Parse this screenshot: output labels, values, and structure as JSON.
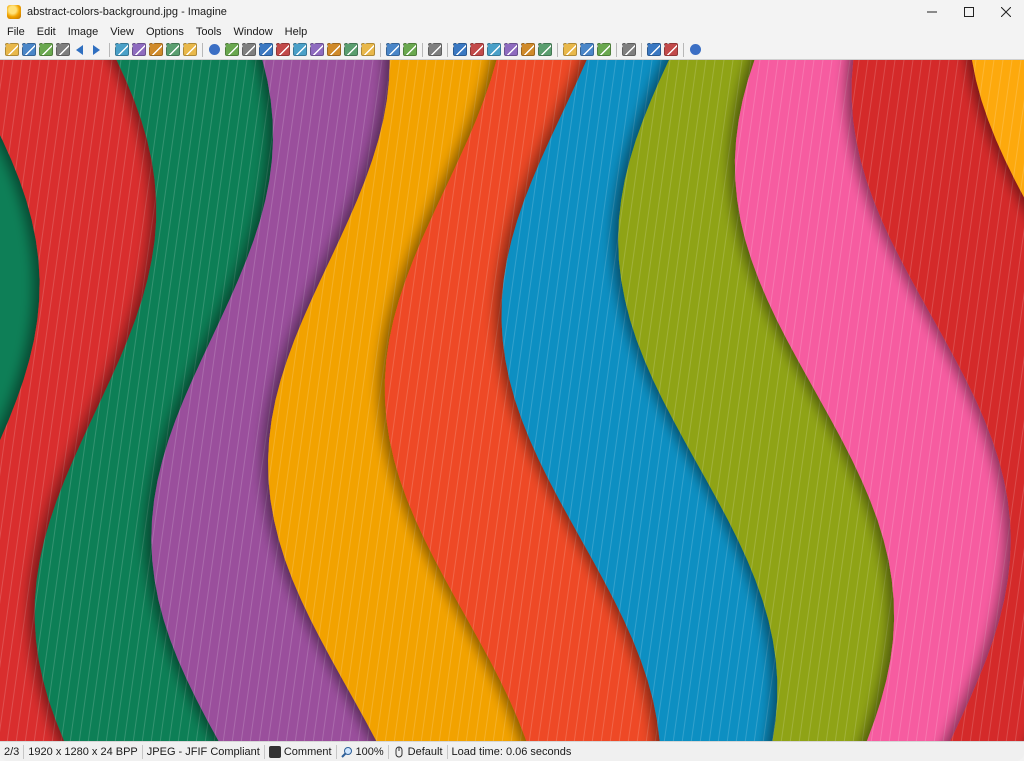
{
  "window": {
    "title": "abstract-colors-background.jpg - Imagine"
  },
  "menu": [
    "File",
    "Edit",
    "Image",
    "View",
    "Options",
    "Tools",
    "Window",
    "Help"
  ],
  "toolbar": {
    "icons": [
      "new-icon",
      "open-icon",
      "save-icon",
      "print-icon",
      "prev-icon",
      "next-icon",
      "sep",
      "cut-icon",
      "copy-icon",
      "paste-icon",
      "undo-icon",
      "redo-icon",
      "sep",
      "info-icon",
      "camera-icon",
      "scanner-icon",
      "rotate-icon",
      "gradient-icon",
      "color-icon",
      "convert-icon",
      "resize-icon",
      "crop-icon",
      "effects-icon",
      "sep",
      "slideshow-icon",
      "fullscreen-icon",
      "sep",
      "refresh-icon",
      "sep",
      "zoom-in-icon",
      "zoom-out-icon",
      "zoom-fit-icon",
      "zoom-actual-icon",
      "zoom-window-icon",
      "thumbnail-icon",
      "sep",
      "monitor-icon",
      "desktop-icon",
      "settings-icon",
      "sep",
      "plugin-icon",
      "sep",
      "batch-icon",
      "compare-icon",
      "sep",
      "help-icon"
    ]
  },
  "colors": {
    "stripes": [
      "#d92d2d",
      "#0e7f57",
      "#9a4f9c",
      "#f2a205",
      "#ee4a25",
      "#0d8fc2",
      "#8fa315",
      "#f65ba0",
      "#d42b2b",
      "#fda90a"
    ],
    "accent": "#0d8fc2"
  },
  "status": {
    "index": "2/3",
    "dimensions": "1920 x 1280 x 24 BPP",
    "format": "JPEG - JFIF Compliant",
    "comment": "Comment",
    "zoom": "100%",
    "profile": "Default",
    "load_time": "Load time: 0.06 seconds"
  }
}
